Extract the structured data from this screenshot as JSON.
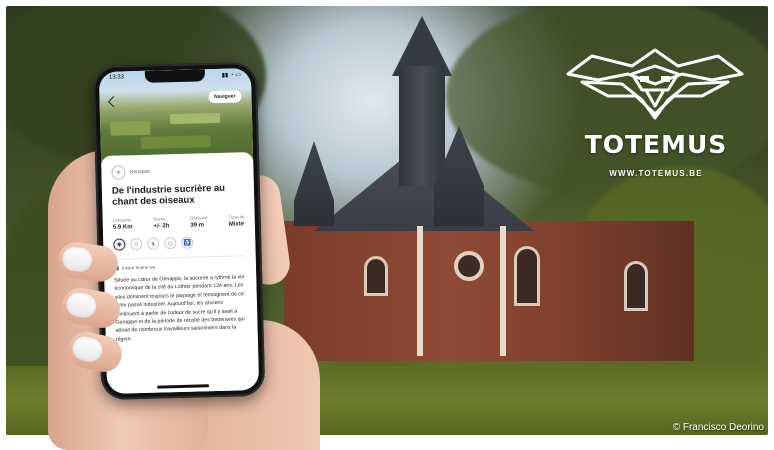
{
  "brand": {
    "name": "TOTEMUS",
    "url": "WWW.TOTEMUS.BE",
    "logo_icon": "totem-mask-logo-icon"
  },
  "photo_credit": "© Francisco Deorino",
  "phone": {
    "status_time": "13:33",
    "nav_button": "Naviguer",
    "location_name": "Genappe",
    "title": "De l'industrie sucrière au chant des oiseaux",
    "stats": [
      {
        "label": "Longueur",
        "value": "5.9 Km"
      },
      {
        "label": "Durée",
        "value": "+/- 2h"
      },
      {
        "label": "Dénivelé",
        "value": "39 m"
      },
      {
        "label": "Type de",
        "value": "Mixte"
      }
    ],
    "category_icons": [
      "walk-icon",
      "bike-icon",
      "horse-icon",
      "stroller-icon",
      "accessibility-icon"
    ],
    "audio_label": "Insten Scene ive",
    "description": "Située au cœur de Genappe, la sucrerie a rythmé la vie économique de la cité du Lothier pendant 134 ans. Les silos dominent toujours le paysage et témoignent de ce riche passé industriel. Aujourd'hui, les anciens continuent à parler de l'odeur de sucre qu'il y avait à Genappe et de la période de récolte des betteraves qui attirait de nombreux travailleurs saisonniers dans la région."
  }
}
